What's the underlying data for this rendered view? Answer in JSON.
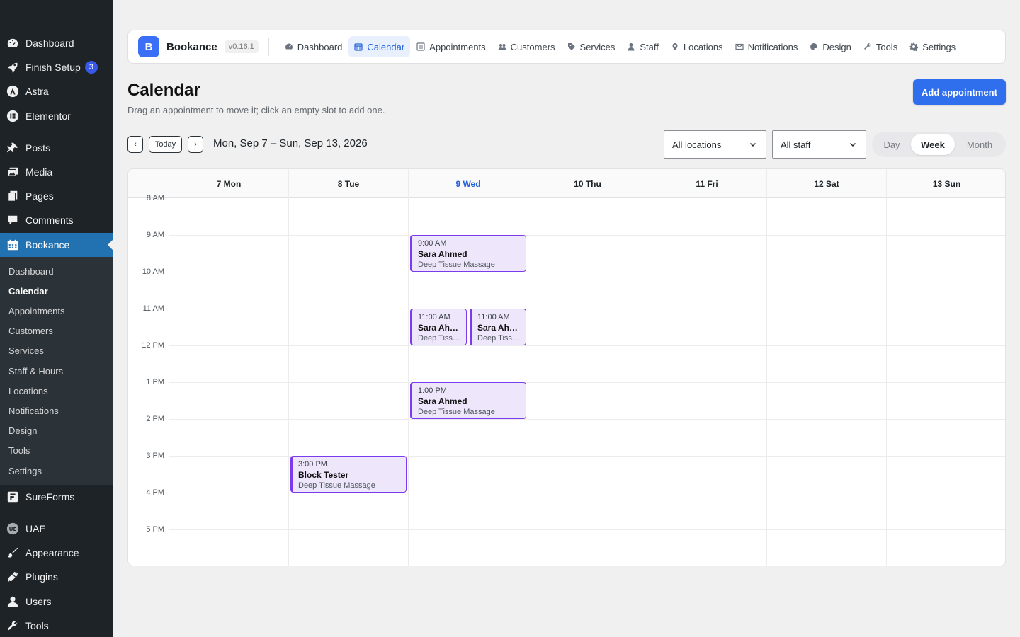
{
  "sidebar": {
    "items": [
      {
        "label": "Dashboard",
        "icon": "dashboard-icon"
      },
      {
        "label": "Finish Setup",
        "icon": "rocket-icon",
        "badge": "3"
      },
      {
        "label": "Astra",
        "icon": "astra-icon"
      },
      {
        "label": "Elementor",
        "icon": "elementor-icon"
      },
      {
        "label": "Posts",
        "icon": "pin-icon"
      },
      {
        "label": "Media",
        "icon": "media-icon"
      },
      {
        "label": "Pages",
        "icon": "pages-icon"
      },
      {
        "label": "Comments",
        "icon": "comment-icon"
      },
      {
        "label": "Bookance",
        "icon": "calendar-icon"
      },
      {
        "label": "SureForms",
        "icon": "sureforms-icon"
      },
      {
        "label": "UAE",
        "icon": "uae-icon"
      },
      {
        "label": "Appearance",
        "icon": "brush-icon"
      },
      {
        "label": "Plugins",
        "icon": "plug-icon"
      },
      {
        "label": "Users",
        "icon": "user-icon"
      },
      {
        "label": "Tools",
        "icon": "wrench-icon"
      }
    ],
    "submenu": [
      "Dashboard",
      "Calendar",
      "Appointments",
      "Customers",
      "Services",
      "Staff & Hours",
      "Locations",
      "Notifications",
      "Design",
      "Tools",
      "Settings"
    ]
  },
  "topnav": {
    "logo_letter": "B",
    "brand": "Bookance",
    "version": "v0.16.1",
    "links": [
      "Dashboard",
      "Calendar",
      "Appointments",
      "Customers",
      "Services",
      "Staff",
      "Locations",
      "Notifications",
      "Design",
      "Tools",
      "Settings"
    ]
  },
  "header": {
    "title": "Calendar",
    "subtitle": "Drag an appointment to move it; click an empty slot to add one.",
    "add_button": "Add appointment"
  },
  "toolbar": {
    "prev": "‹",
    "today": "Today",
    "next": "›",
    "range": "Mon, Sep 7 – Sun, Sep 13, 2026",
    "location_select": "All locations",
    "staff_select": "All staff",
    "views": [
      "Day",
      "Week",
      "Month"
    ],
    "active_view": "Week"
  },
  "calendar": {
    "days": [
      "7 Mon",
      "8 Tue",
      "9 Wed",
      "10 Thu",
      "11 Fri",
      "12 Sat",
      "13 Sun"
    ],
    "today_index": 2,
    "hours": [
      "8 AM",
      "9 AM",
      "10 AM",
      "11 AM",
      "12 PM",
      "1 PM",
      "2 PM",
      "3 PM",
      "4 PM",
      "5 PM"
    ],
    "appointments": [
      {
        "time": "9:00 AM",
        "name": "Sara Ahmed",
        "service": "Deep Tissue Massage"
      },
      {
        "time": "11:00 AM",
        "name": "Sara Ahmed",
        "service": "Deep Tissue Massage"
      },
      {
        "time": "11:00 AM",
        "name": "Sara Ahmed",
        "service": "Deep Tissue Massage"
      },
      {
        "time": "1:00 PM",
        "name": "Sara Ahmed",
        "service": "Deep Tissue Massage"
      },
      {
        "time": "3:00 PM",
        "name": "Block Tester",
        "service": "Deep Tissue Massage"
      }
    ]
  },
  "colors": {
    "wp_sidebar": "#1d2327",
    "wp_active": "#2271b1",
    "accent": "#2f6fed",
    "appointment_border": "#7c3aed",
    "appointment_bg": "#eee6fb"
  }
}
